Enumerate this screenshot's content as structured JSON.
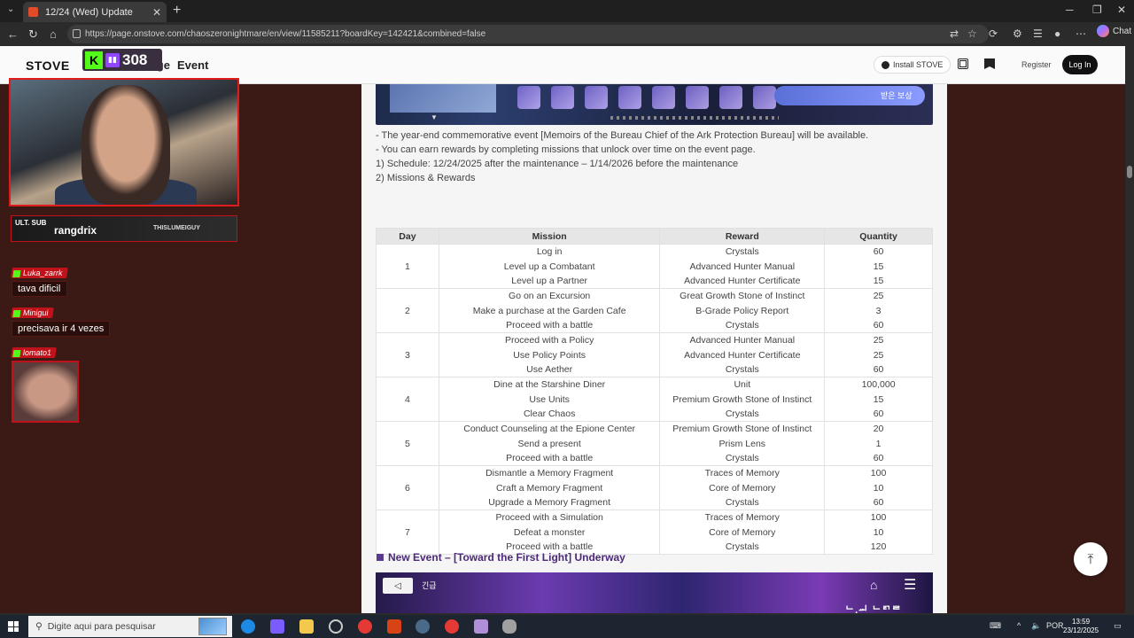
{
  "browser": {
    "tab_title": "12/24 (Wed) Update",
    "url": "https://page.onstove.com/chaoszeronightmare/en/view/11585211?boardKey=142421&combined=false",
    "chat_label": "Chat"
  },
  "site": {
    "logo": "STOVE",
    "nav": {
      "lounge": "Lounge",
      "event": "Event"
    },
    "install_label": "Install STOVE",
    "register_label": "Register",
    "login_label": "Log In"
  },
  "article": {
    "banner_top_label": "받은 보상",
    "description": [
      "- The year-end commemorative event [Memoirs of the Bureau Chief of the Ark Protection Bureau] will be available.",
      "- You can earn rewards by completing missions that unlock over time on the event page.",
      "1) Schedule: 12/24/2025 after the maintenance – 1/14/2026 before the maintenance",
      "2) Missions & Rewards"
    ],
    "table": {
      "headers": [
        "Day",
        "Mission",
        "Reward",
        "Quantity"
      ],
      "groups": [
        {
          "day": "1",
          "rows": [
            {
              "mission": "Log in",
              "reward": "Crystals",
              "quantity": "60"
            },
            {
              "mission": "Level up a Combatant",
              "reward": "Advanced Hunter Manual",
              "quantity": "15"
            },
            {
              "mission": "Level up a Partner",
              "reward": "Advanced Hunter Certificate",
              "quantity": "15"
            }
          ]
        },
        {
          "day": "2",
          "rows": [
            {
              "mission": "Go on an Excursion",
              "reward": "Great Growth Stone of Instinct",
              "quantity": "25"
            },
            {
              "mission": "Make a purchase at the Garden Cafe",
              "reward": "B-Grade Policy Report",
              "quantity": "3"
            },
            {
              "mission": "Proceed with a battle",
              "reward": "Crystals",
              "quantity": "60"
            }
          ]
        },
        {
          "day": "3",
          "rows": [
            {
              "mission": "Proceed with a Policy",
              "reward": "Advanced Hunter Manual",
              "quantity": "25"
            },
            {
              "mission": "Use Policy Points",
              "reward": "Advanced Hunter Certificate",
              "quantity": "25"
            },
            {
              "mission": "Use Aether",
              "reward": "Crystals",
              "quantity": "60"
            }
          ]
        },
        {
          "day": "4",
          "rows": [
            {
              "mission": "Dine at the Starshine Diner",
              "reward": "Unit",
              "quantity": "100,000"
            },
            {
              "mission": "Use Units",
              "reward": "Premium Growth Stone of Instinct",
              "quantity": "15"
            },
            {
              "mission": "Clear Chaos",
              "reward": "Crystals",
              "quantity": "60"
            }
          ]
        },
        {
          "day": "5",
          "rows": [
            {
              "mission": "Conduct Counseling at the Epione Center",
              "reward": "Premium Growth Stone of Instinct",
              "quantity": "20"
            },
            {
              "mission": "Send a present",
              "reward": "Prism Lens",
              "quantity": "1"
            },
            {
              "mission": "Proceed with a battle",
              "reward": "Crystals",
              "quantity": "60"
            }
          ]
        },
        {
          "day": "6",
          "rows": [
            {
              "mission": "Dismantle a Memory Fragment",
              "reward": "Traces of Memory",
              "quantity": "100"
            },
            {
              "mission": "Craft a Memory Fragment",
              "reward": "Core of Memory",
              "quantity": "10"
            },
            {
              "mission": "Upgrade a Memory Fragment",
              "reward": "Crystals",
              "quantity": "60"
            }
          ]
        },
        {
          "day": "7",
          "rows": [
            {
              "mission": "Proceed with a Simulation",
              "reward": "Traces of Memory",
              "quantity": "100"
            },
            {
              "mission": "Defeat a monster",
              "reward": "Core of Memory",
              "quantity": "10"
            },
            {
              "mission": "Proceed with a battle",
              "reward": "Crystals",
              "quantity": "120"
            }
          ]
        }
      ]
    },
    "next_section_title": "New Event – [Toward the First Light] Underway",
    "banner_bottom_label": "긴급",
    "banner_bottom_footer": "ᄂ.ᆈ ᄂᄅᄀᄅ"
  },
  "stream": {
    "viewer_count": "308",
    "sub_tag": "ULT. SUB",
    "subscriber": "rangdrix",
    "brand": "THISLUMEIGUY",
    "chat": [
      {
        "user": "Luka_zarrk",
        "message": "tava dificil"
      },
      {
        "user": "Minigui",
        "message": "precisava ir 4 vezes"
      },
      {
        "user": "lomato1",
        "message": ""
      }
    ]
  },
  "taskbar": {
    "search_placeholder": "Digite aqui para pesquisar",
    "lang": "POR",
    "time": "13:59",
    "date": "23/12/2025"
  },
  "colors": {
    "page_bg": "#3b1a15",
    "section_accent": "#4b2a7a",
    "stream_red": "#c0121a",
    "kick_green": "#53fc18"
  }
}
